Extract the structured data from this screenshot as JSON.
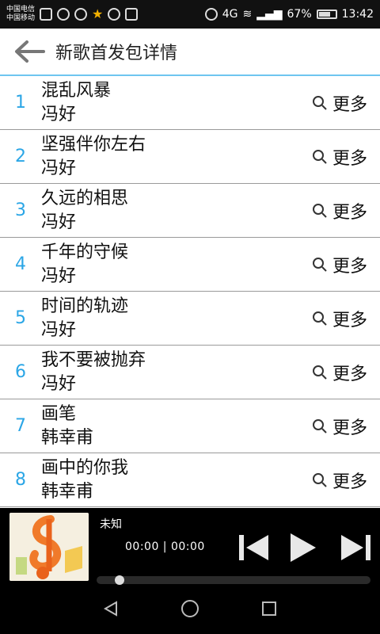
{
  "status_bar": {
    "carrier_top": "中国电信",
    "carrier_bottom": "中国移动",
    "network_type": "4G",
    "battery_percent": "67%",
    "time": "13:42"
  },
  "header": {
    "title": "新歌首发包详情"
  },
  "songs": [
    {
      "index": "1",
      "title": "混乱风暴",
      "artist": "冯好",
      "more_label": "更多"
    },
    {
      "index": "2",
      "title": "坚强伴你左右",
      "artist": "冯好",
      "more_label": "更多"
    },
    {
      "index": "3",
      "title": "久远的相思",
      "artist": "冯好",
      "more_label": "更多"
    },
    {
      "index": "4",
      "title": "千年的守候",
      "artist": "冯好",
      "more_label": "更多"
    },
    {
      "index": "5",
      "title": "时间的轨迹",
      "artist": "冯好",
      "more_label": "更多"
    },
    {
      "index": "6",
      "title": "我不要被抛弃",
      "artist": "冯好",
      "more_label": "更多"
    },
    {
      "index": "7",
      "title": "画笔",
      "artist": "韩幸甫",
      "more_label": "更多"
    },
    {
      "index": "8",
      "title": "画中的你我",
      "artist": "韩幸甫",
      "more_label": "更多"
    }
  ],
  "player": {
    "track_name": "未知",
    "time": "00:00 | 00:00",
    "progress_fraction": 0.02
  },
  "colors": {
    "accent": "#2ba6e6",
    "header_rule": "#6ec6f0"
  }
}
